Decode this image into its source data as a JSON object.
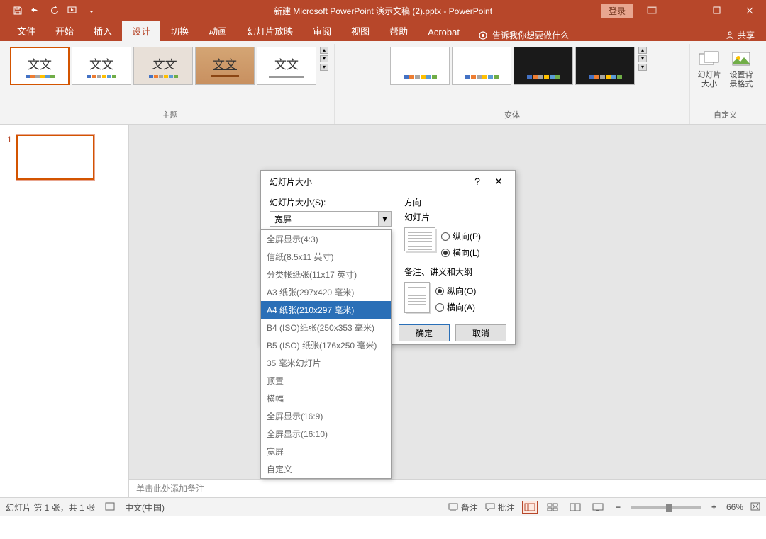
{
  "titlebar": {
    "title": "新建 Microsoft PowerPoint 演示文稿 (2).pptx - PowerPoint",
    "login": "登录"
  },
  "tabs": {
    "file": "文件",
    "home": "开始",
    "insert": "插入",
    "design": "设计",
    "transitions": "切换",
    "animations": "动画",
    "slideshow": "幻灯片放映",
    "review": "审阅",
    "view": "视图",
    "help": "帮助",
    "acrobat": "Acrobat",
    "tellme": "告诉我你想要做什么",
    "share": "共享"
  },
  "ribbon": {
    "theme_text": "文文",
    "themes_label": "主题",
    "variants_label": "变体",
    "customize_label": "自定义",
    "slide_size": "幻灯片大小",
    "format_bg": "设置背景格式"
  },
  "slides": {
    "num1": "1"
  },
  "notes": {
    "placeholder": "单击此处添加备注"
  },
  "dialog": {
    "title": "幻灯片大小",
    "size_label": "幻灯片大小(S):",
    "combo_value": "宽屏",
    "orientation": "方向",
    "slide_orient": "幻灯片",
    "notes_orient": "备注、讲义和大纲",
    "portrait": "纵向(P)",
    "landscape": "横向(L)",
    "portrait_o": "纵向(O)",
    "landscape_a": "横向(A)",
    "ok": "确定",
    "cancel": "取消"
  },
  "dropdown": {
    "items": [
      "全屏显示(4:3)",
      "信纸(8.5x11 英寸)",
      "分类帐纸张(11x17 英寸)",
      "A3 纸张(297x420 毫米)",
      "A4 纸张(210x297 毫米)",
      "B4 (ISO)纸张(250x353 毫米)",
      "B5 (ISO) 纸张(176x250 毫米)",
      "35 毫米幻灯片",
      "顶置",
      "横幅",
      "全屏显示(16:9)",
      "全屏显示(16:10)",
      "宽屏",
      "自定义"
    ]
  },
  "status": {
    "slide_info": "幻灯片 第 1 张，共 1 张",
    "lang": "中文(中国)",
    "notes": "备注",
    "comments": "批注",
    "zoom": "66%"
  }
}
